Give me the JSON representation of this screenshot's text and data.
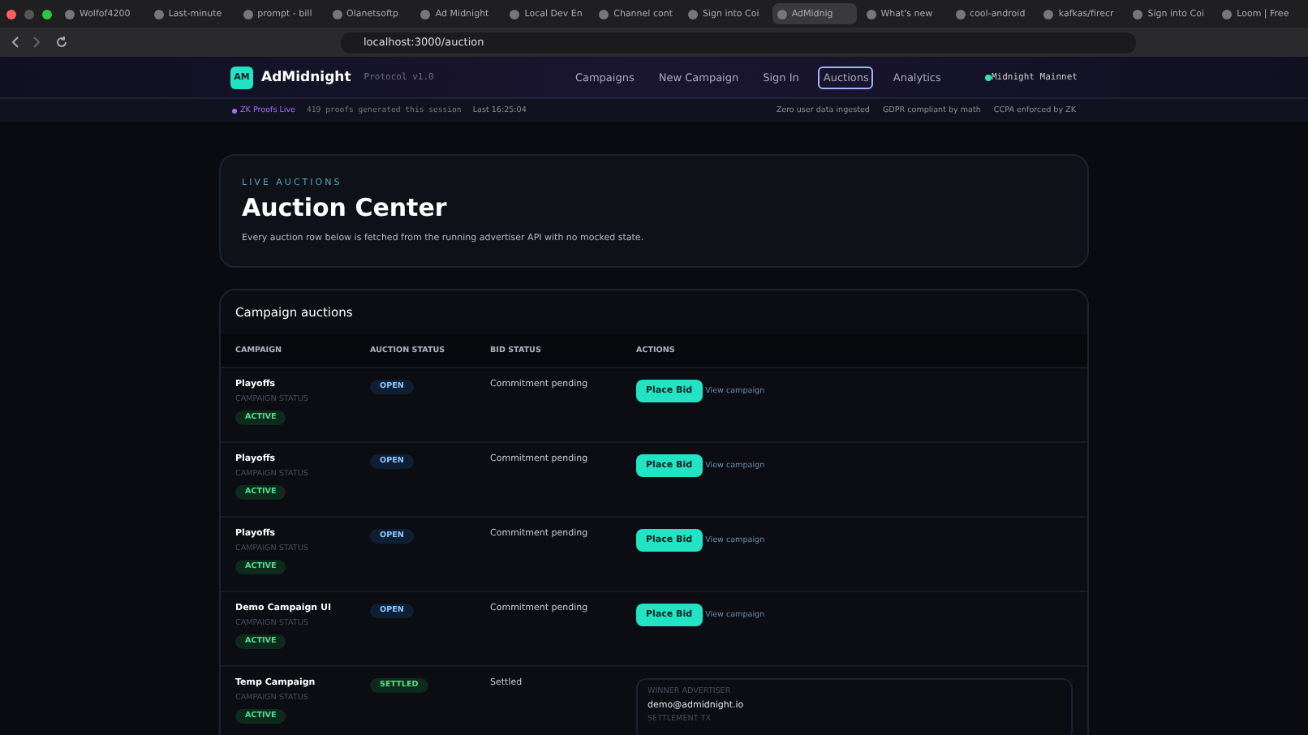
{
  "browser": {
    "tabs": [
      {
        "title": "Wolfof4200",
        "selected": false
      },
      {
        "title": "Last-minute",
        "selected": false
      },
      {
        "title": "prompt - bill",
        "selected": false
      },
      {
        "title": "Olanetsoftp",
        "selected": false
      },
      {
        "title": "Ad Midnight",
        "selected": false
      },
      {
        "title": "Local Dev En",
        "selected": false
      },
      {
        "title": "Channel cont",
        "selected": false
      },
      {
        "title": "Sign into Coi",
        "selected": false
      },
      {
        "title": "AdMidnig",
        "selected": true
      },
      {
        "title": "What's new",
        "selected": false
      },
      {
        "title": "cool-android",
        "selected": false
      },
      {
        "title": "kafkas/firecr",
        "selected": false
      },
      {
        "title": "Sign into Coi",
        "selected": false
      },
      {
        "title": "Loom | Free",
        "selected": false
      }
    ],
    "url": "localhost:3000/auction"
  },
  "nav": {
    "logo": "AM",
    "brand": "AdMidnight",
    "version": "Protocol v1.0",
    "links": [
      {
        "label": "Campaigns",
        "selected": false
      },
      {
        "label": "New Campaign",
        "selected": false
      },
      {
        "label": "Sign In",
        "selected": false
      },
      {
        "label": "Auctions",
        "selected": true
      },
      {
        "label": "Analytics",
        "selected": false
      }
    ],
    "network": "Midnight Mainnet"
  },
  "strip": {
    "live": "ZK Proofs Live",
    "proofs": "419 proofs generated this session",
    "last": "Last 16:25:04",
    "claims": [
      "Zero user data ingested",
      "GDPR compliant by math",
      "CCPA enforced by ZK"
    ]
  },
  "hero": {
    "eyebrow": "LIVE AUCTIONS",
    "title": "Auction Center",
    "subtitle": "Every auction row below is fetched from the running advertiser API with no mocked state."
  },
  "table": {
    "title": "Campaign auctions",
    "columns": [
      "CAMPAIGN",
      "AUCTION STATUS",
      "BID STATUS",
      "ACTIONS"
    ],
    "rows": [
      {
        "campaign": "Playoffs",
        "status_label": "CAMPAIGN STATUS",
        "campaign_status": "ACTIVE",
        "auction_status": "OPEN",
        "bid_status": "Commitment pending",
        "kind": "open",
        "button": "Place Bid",
        "link": "View campaign"
      },
      {
        "campaign": "Playoffs",
        "status_label": "CAMPAIGN STATUS",
        "campaign_status": "ACTIVE",
        "auction_status": "OPEN",
        "bid_status": "Commitment pending",
        "kind": "open",
        "button": "Place Bid",
        "link": "View campaign"
      },
      {
        "campaign": "Playoffs",
        "status_label": "CAMPAIGN STATUS",
        "campaign_status": "ACTIVE",
        "auction_status": "OPEN",
        "bid_status": "Commitment pending",
        "kind": "open",
        "button": "Place Bid",
        "link": "View campaign"
      },
      {
        "campaign": "Demo Campaign UI",
        "status_label": "CAMPAIGN STATUS",
        "campaign_status": "ACTIVE",
        "auction_status": "OPEN",
        "bid_status": "Commitment pending",
        "kind": "open",
        "button": "Place Bid",
        "link": "View campaign"
      },
      {
        "campaign": "Temp Campaign",
        "status_label": "CAMPAIGN STATUS",
        "campaign_status": "ACTIVE",
        "auction_status": "SETTLED",
        "bid_status": "Settled",
        "kind": "settled",
        "winner_label": "WINNER ADVERTISER",
        "winner": "demo@admidnight.io",
        "tx_label": "SETTLEMENT TX"
      }
    ]
  }
}
